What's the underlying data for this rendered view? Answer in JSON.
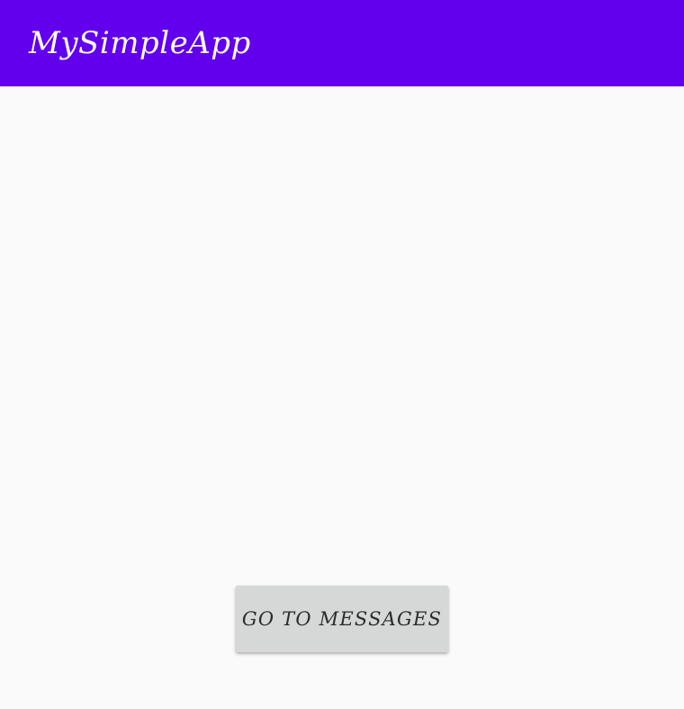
{
  "app_bar": {
    "title": "MySimpleApp",
    "color": "#6200ee"
  },
  "main": {
    "go_to_messages_label": "GO TO MESSAGES"
  },
  "colors": {
    "background": "#fafafa",
    "button": "#d6d7d7"
  }
}
